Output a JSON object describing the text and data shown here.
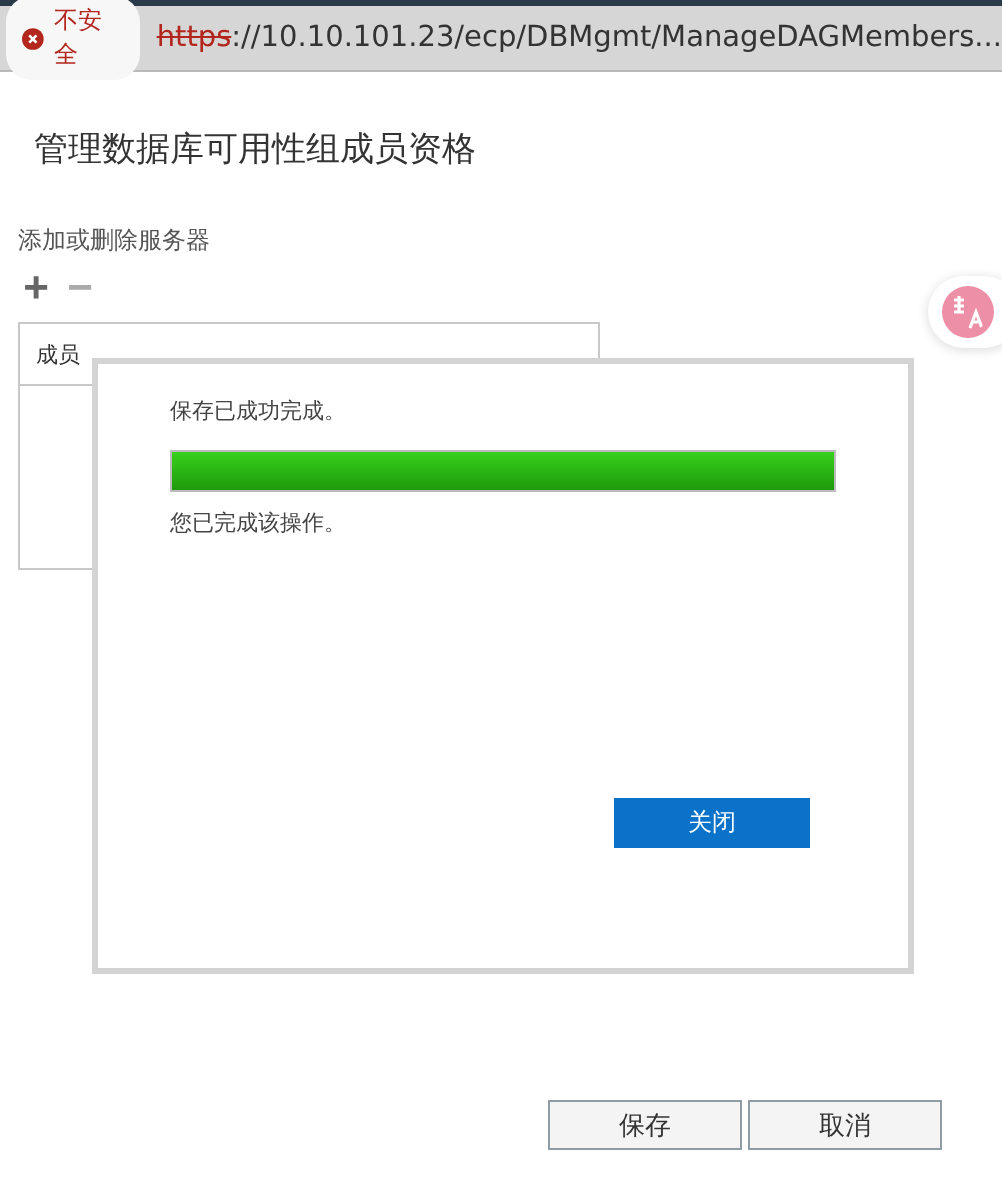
{
  "address_bar": {
    "security_label": "不安全",
    "scheme": "https",
    "url": "://10.10.101.23/ecp/DBMgmt/ManageDAGMembers..."
  },
  "page": {
    "title": "管理数据库可用性组成员资格",
    "section_label": "添加或删除服务器",
    "add_button": "+",
    "remove_button": "−",
    "table": {
      "columns": [
        "成员"
      ]
    }
  },
  "dialog": {
    "message": "保存已成功完成。",
    "progress": {
      "level": 1.0
    },
    "detail": "您已完成该操作。",
    "close_button": "关闭"
  },
  "buttons": [
    "保存",
    "取消"
  ]
}
